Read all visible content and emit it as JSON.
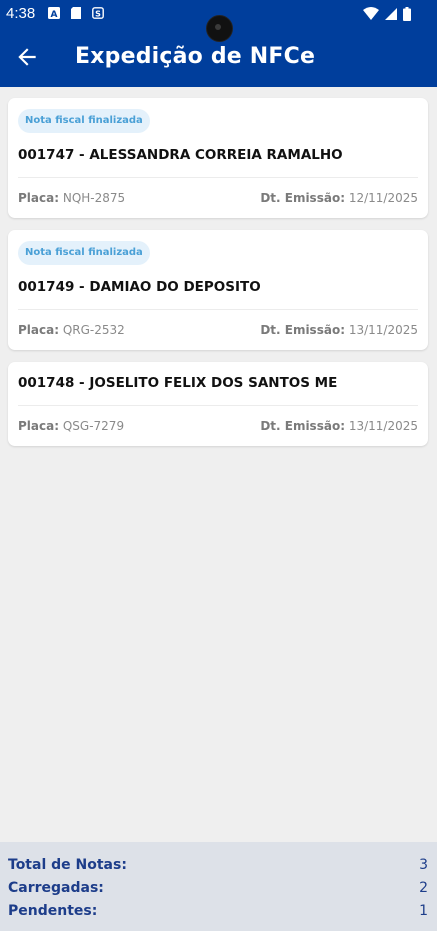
{
  "status_bar": {
    "time": "4:38"
  },
  "app_bar": {
    "title": "Expedição de NFCe"
  },
  "cards": [
    {
      "badge": "Nota fiscal finalizada",
      "title": "001747 - ALESSANDRA CORREIA RAMALHO",
      "placa_label": "Placa:",
      "placa": "NQH-2875",
      "emissao_label": "Dt. Emissão:",
      "emissao": "12/11/2025"
    },
    {
      "badge": "Nota fiscal finalizada",
      "title": "001749 - DAMIAO DO DEPOSITO",
      "placa_label": "Placa:",
      "placa": "QRG-2532",
      "emissao_label": "Dt. Emissão:",
      "emissao": "13/11/2025"
    },
    {
      "title": "001748 - JOSELITO FELIX DOS SANTOS ME",
      "placa_label": "Placa:",
      "placa": "QSG-7279",
      "emissao_label": "Dt. Emissão:",
      "emissao": "13/11/2025"
    }
  ],
  "footer": {
    "total_label": "Total de Notas:",
    "total_value": "3",
    "carregadas_label": "Carregadas:",
    "carregadas_value": "2",
    "pendentes_label": "Pendentes:",
    "pendentes_value": "1"
  },
  "colors": {
    "primary": "#003e9c",
    "badge_bg": "#e4f1fb",
    "badge_text": "#4aa0d6",
    "footer_bg": "#dde1e8",
    "footer_text": "#1d3d8a"
  }
}
